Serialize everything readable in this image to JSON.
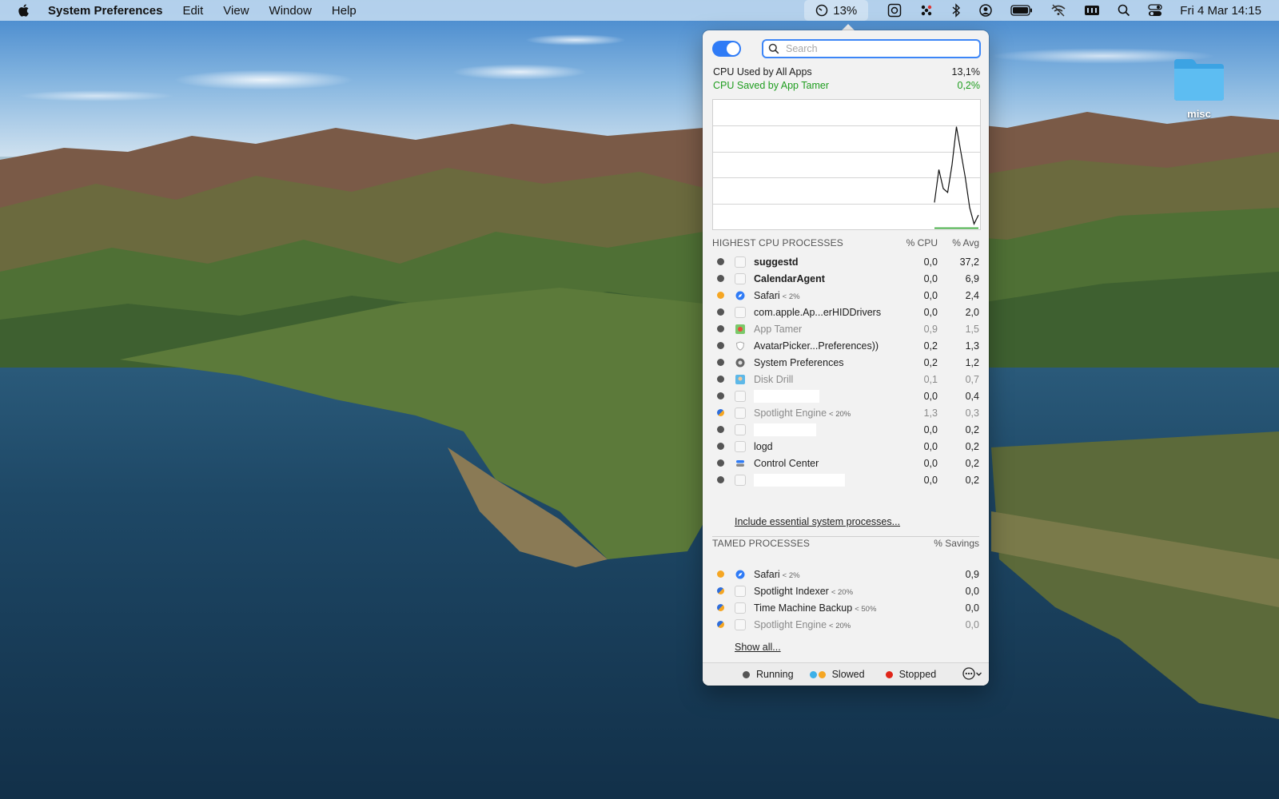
{
  "menubar": {
    "app_name": "System Preferences",
    "menus": [
      "Edit",
      "View",
      "Window",
      "Help"
    ],
    "cpu_percent": "13%",
    "datetime": "Fri 4 Mar  14:15"
  },
  "desktop": {
    "folder_label": "misc"
  },
  "popover": {
    "search_placeholder": "Search",
    "toggle_on": true,
    "cpu_used_label": "CPU Used by All Apps",
    "cpu_used_value": "13,1%",
    "cpu_saved_label": "CPU Saved by App Tamer",
    "cpu_saved_value": "0,2%",
    "highest": {
      "title": "HIGHEST CPU PROCESSES",
      "col_cpu": "% CPU",
      "col_avg": "% Avg",
      "rows": [
        {
          "name": "suggestd",
          "limit": "",
          "cpu": "0,0",
          "avg": "37,2",
          "bold": true,
          "grey": false,
          "status": "running"
        },
        {
          "name": "CalendarAgent",
          "limit": "",
          "cpu": "0,0",
          "avg": "6,9",
          "bold": true,
          "grey": false,
          "status": "running"
        },
        {
          "name": "Safari",
          "limit": "< 2%",
          "cpu": "0,0",
          "avg": "2,4",
          "bold": false,
          "grey": false,
          "status": "slowed"
        },
        {
          "name": "com.apple.Ap...erHIDDrivers",
          "limit": "",
          "cpu": "0,0",
          "avg": "2,0",
          "bold": false,
          "grey": false,
          "status": "running"
        },
        {
          "name": "App Tamer",
          "limit": "",
          "cpu": "0,9",
          "avg": "1,5",
          "bold": false,
          "grey": true,
          "status": "running"
        },
        {
          "name": "AvatarPicker...Preferences))",
          "limit": "",
          "cpu": "0,2",
          "avg": "1,3",
          "bold": false,
          "grey": false,
          "status": "running"
        },
        {
          "name": "System Preferences",
          "limit": "",
          "cpu": "0,2",
          "avg": "1,2",
          "bold": false,
          "grey": false,
          "status": "running"
        },
        {
          "name": "Disk Drill",
          "limit": "",
          "cpu": "0,1",
          "avg": "0,7",
          "bold": false,
          "grey": true,
          "status": "running"
        },
        {
          "name": "",
          "limit": "",
          "cpu": "0,0",
          "avg": "0,4",
          "bold": false,
          "grey": false,
          "status": "running",
          "redacted": 82
        },
        {
          "name": "Spotlight Engine",
          "limit": "< 20%",
          "cpu": "1,3",
          "avg": "0,3",
          "bold": false,
          "grey": true,
          "status": "half"
        },
        {
          "name": "",
          "limit": "",
          "cpu": "0,0",
          "avg": "0,2",
          "bold": false,
          "grey": false,
          "status": "running",
          "redacted": 78
        },
        {
          "name": "logd",
          "limit": "",
          "cpu": "0,0",
          "avg": "0,2",
          "bold": false,
          "grey": false,
          "status": "running"
        },
        {
          "name": "Control Center",
          "limit": "",
          "cpu": "0,0",
          "avg": "0,2",
          "bold": false,
          "grey": false,
          "status": "running"
        },
        {
          "name": "",
          "limit": "",
          "cpu": "0,0",
          "avg": "0,2",
          "bold": false,
          "grey": false,
          "status": "running",
          "redacted": 114
        }
      ],
      "include_link": "Include essential system processes..."
    },
    "tamed": {
      "title": "TAMED PROCESSES",
      "col_savings": "% Savings",
      "rows": [
        {
          "name": "Safari",
          "limit": "< 2%",
          "savings": "0,9",
          "grey": false,
          "status": "slowed"
        },
        {
          "name": "Spotlight Indexer",
          "limit": "< 20%",
          "savings": "0,0",
          "grey": false,
          "status": "half"
        },
        {
          "name": "Time Machine Backup",
          "limit": "< 50%",
          "savings": "0,0",
          "grey": false,
          "status": "half"
        },
        {
          "name": "Spotlight Engine",
          "limit": "< 20%",
          "savings": "0,0",
          "grey": true,
          "status": "half"
        }
      ],
      "show_all_link": "Show all..."
    },
    "legend": {
      "running": "Running",
      "slowed": "Slowed",
      "stopped": "Stopped"
    },
    "colors": {
      "running": "#555555",
      "slowed": "#f5a623",
      "stopped": "#e0261a",
      "slowed_blue": "#3db0e8",
      "saved_green": "#1f9d1f",
      "accent": "#2f7bf6"
    },
    "chart_data": {
      "type": "line",
      "series": [
        {
          "values": [
            0,
            0,
            0,
            0,
            0,
            0,
            0,
            0,
            0,
            0,
            0,
            0,
            0,
            0,
            0,
            0,
            0,
            0,
            0,
            0,
            0,
            0,
            0,
            0,
            0,
            0,
            0,
            0,
            0,
            0,
            0,
            0,
            0,
            0,
            0,
            0,
            0,
            0,
            0,
            0,
            0,
            0,
            0,
            0,
            0,
            0,
            0,
            0,
            0,
            0,
            0,
            0,
            0,
            0,
            0,
            0,
            0,
            0,
            0,
            0,
            0,
            0,
            0,
            0,
            0,
            0,
            0,
            0,
            0,
            0,
            0,
            0,
            0,
            0,
            0,
            0,
            0,
            0,
            0,
            0,
            0,
            0,
            0,
            0,
            0,
            0,
            0,
            0,
            0,
            0,
            0,
            0,
            0,
            0,
            0,
            0,
            0,
            0,
            0,
            0,
            0,
            0,
            0,
            0,
            0,
            0,
            0,
            0,
            0,
            0,
            0,
            0,
            0,
            0,
            0,
            0,
            0,
            0,
            0,
            0,
            0,
            0,
            0,
            0,
            0,
            0,
            0,
            0,
            0,
            0,
            0,
            0,
            0,
            0,
            0,
            0,
            0,
            0,
            0,
            0,
            0,
            0,
            0,
            0,
            0,
            0,
            0,
            0,
            0,
            0,
            0,
            0,
            0,
            0,
            0,
            0,
            0,
            0,
            0,
            0,
            0,
            0,
            0,
            0,
            0,
            0,
            0,
            0,
            0,
            0,
            0,
            0,
            0,
            0,
            0,
            0,
            0,
            0,
            0,
            0,
            0,
            0,
            0,
            0,
            0,
            0,
            0,
            0,
            0,
            0,
            0,
            0,
            0,
            0,
            0,
            0,
            0,
            0,
            0,
            0,
            0,
            0,
            0,
            0,
            0,
            0,
            0,
            0,
            0,
            0,
            0,
            0,
            0,
            0,
            0,
            0,
            0,
            0,
            0,
            0,
            0,
            0,
            0,
            0,
            0,
            0,
            0,
            0,
            0,
            0,
            0,
            0,
            0,
            0,
            0,
            0,
            0,
            0,
            0,
            0,
            0,
            0,
            0,
            0,
            0,
            0,
            0,
            0,
            0,
            0,
            0,
            0,
            0,
            0,
            0,
            0,
            0,
            0,
            0,
            0,
            0,
            0,
            0,
            0,
            0,
            0,
            0,
            0,
            0,
            0,
            0,
            0,
            0,
            0,
            0,
            0,
            0,
            0,
            0,
            0,
            0,
            0,
            0,
            0,
            0,
            0,
            0,
            0,
            0,
            0,
            0,
            0,
            0,
            0,
            0,
            0,
            0,
            0,
            0,
            0
          ]
        },
        {
          "values": [
            20,
            46,
            31,
            28,
            50,
            80,
            60,
            40,
            16,
            3,
            10
          ]
        },
        {
          "values": [
            0,
            0,
            0,
            0,
            0,
            0,
            0,
            0,
            0,
            0,
            0
          ]
        }
      ],
      "ylim": [
        0,
        100
      ],
      "grid": true,
      "gridlines": 5
    }
  }
}
